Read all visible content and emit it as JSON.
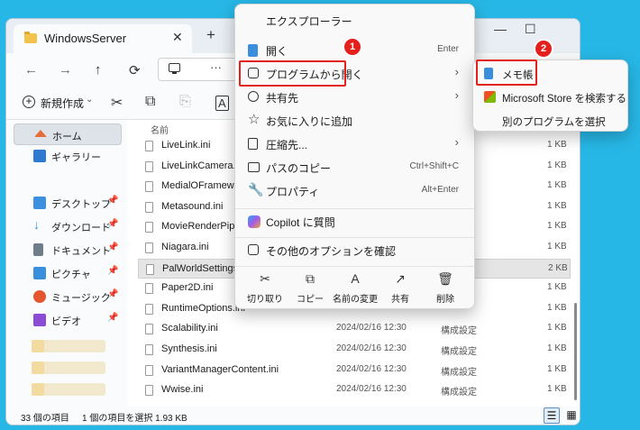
{
  "window": {
    "tab_title": "WindowsServer",
    "tab_close": "✕",
    "tab_new": "+",
    "nav_back": "←",
    "nav_forward": "→",
    "nav_up": "↑",
    "nav_refresh": "⟳",
    "addr_more": "···",
    "minimize": "—",
    "maximize": "☐"
  },
  "toolbar": {
    "new_label": "新規作成",
    "new_chevron": "⌄",
    "icons": [
      "✂",
      "⧉",
      "⎘",
      "A"
    ]
  },
  "sidebar": {
    "items": [
      {
        "label": "ホーム",
        "icon": "home-icon",
        "color": "#e36e3b"
      },
      {
        "label": "ギャラリー",
        "icon": "gallery-icon",
        "color": "#2f7ad1"
      },
      {
        "label": "デスクトップ",
        "icon": "desktop-icon",
        "color": "#3d8fe0"
      },
      {
        "label": "ダウンロード",
        "icon": "download-icon",
        "color": "#3592d8"
      },
      {
        "label": "ドキュメント",
        "icon": "documents-icon",
        "color": "#6f7c8a"
      },
      {
        "label": "ピクチャ",
        "icon": "pictures-icon",
        "color": "#3a8fdc"
      },
      {
        "label": "ミュージック",
        "icon": "music-icon",
        "color": "#e4572e"
      },
      {
        "label": "ビデオ",
        "icon": "video-icon",
        "color": "#8c4bd4"
      }
    ],
    "pin": "📌"
  },
  "files": {
    "column_name": "名前",
    "rows": [
      {
        "name": "LiveLink.ini",
        "date": "",
        "type": "",
        "size": "1 KB"
      },
      {
        "name": "LiveLinkCamera.ini",
        "date": "",
        "type": "",
        "size": "1 KB"
      },
      {
        "name": "MedialOFramework.ini",
        "date": "",
        "type": "",
        "size": "1 KB"
      },
      {
        "name": "Metasound.ini",
        "date": "",
        "type": "",
        "size": "1 KB"
      },
      {
        "name": "MovieRenderPipeline",
        "date": "",
        "type": "",
        "size": "1 KB"
      },
      {
        "name": "Niagara.ini",
        "date": "",
        "type": "",
        "size": "1 KB"
      },
      {
        "name": "PalWorldSettings.ini",
        "date": "",
        "type": "",
        "size": "2 KB"
      },
      {
        "name": "Paper2D.ini",
        "date": "",
        "type": "",
        "size": "1 KB"
      },
      {
        "name": "RuntimeOptions.ini",
        "date": "",
        "type": "",
        "size": "1 KB"
      },
      {
        "name": "Scalability.ini",
        "date": "2024/02/16 12:30",
        "type": "構成設定",
        "size": "1 KB"
      },
      {
        "name": "Synthesis.ini",
        "date": "2024/02/16 12:30",
        "type": "構成設定",
        "size": "1 KB"
      },
      {
        "name": "VariantManagerContent.ini",
        "date": "2024/02/16 12:30",
        "type": "構成設定",
        "size": "1 KB"
      },
      {
        "name": "Wwise.ini",
        "date": "2024/02/16 12:30",
        "type": "構成設定",
        "size": "1 KB"
      }
    ]
  },
  "status": {
    "count": "33 個の項目",
    "selected": "1 個の項目を選択  1.93 KB"
  },
  "context_menu": {
    "title": "エクスプローラー",
    "items": [
      {
        "label": "開く",
        "shortcut": "Enter",
        "arrow": ""
      },
      {
        "label": "プログラムから開く",
        "shortcut": "",
        "arrow": "›"
      },
      {
        "label": "共有先",
        "shortcut": "",
        "arrow": "›"
      },
      {
        "label": "お気に入りに追加",
        "shortcut": "",
        "arrow": ""
      },
      {
        "label": "圧縮先...",
        "shortcut": "",
        "arrow": "›"
      },
      {
        "label": "パスのコピー",
        "shortcut": "Ctrl+Shift+C",
        "arrow": ""
      },
      {
        "label": "プロパティ",
        "shortcut": "Alt+Enter",
        "arrow": ""
      },
      {
        "label": "Copilot に質問",
        "shortcut": "",
        "arrow": ""
      },
      {
        "label": "その他のオプションを確認",
        "shortcut": "",
        "arrow": ""
      }
    ],
    "actions": [
      {
        "label": "切り取り",
        "icon": "✂"
      },
      {
        "label": "コピー",
        "icon": "⧉"
      },
      {
        "label": "名前の変更",
        "icon": "A"
      },
      {
        "label": "共有",
        "icon": "↗"
      },
      {
        "label": "削除",
        "icon": "🗑"
      }
    ]
  },
  "submenu": {
    "items": [
      {
        "label": "メモ帳"
      },
      {
        "label": "Microsoft Store を検索する"
      },
      {
        "label": "別のプログラムを選択"
      }
    ]
  },
  "callouts": {
    "badge1": "1",
    "badge2": "2",
    "color": "#e3201b"
  }
}
